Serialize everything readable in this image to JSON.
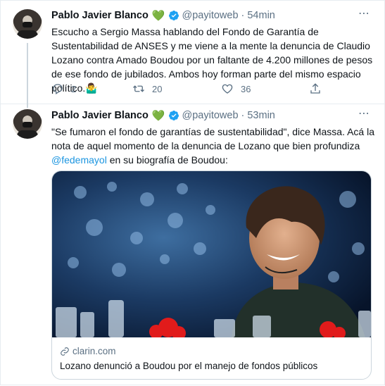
{
  "tweets": [
    {
      "author": "Pablo Javier Blanco",
      "emoji": "💚",
      "handle": "@payitoweb",
      "separator": "·",
      "time": "54min",
      "text": "Escucho a Sergio Massa hablando del Fondo de Garantía de Sustentabilidad de ANSES y me viene a la mente la denuncia de Claudio Lozano contra Amado Boudou por un faltante de 4.200 millones de pesos de ese fondo de jubilados. Ambos hoy forman parte del mismo espacio político.🤷‍♂️",
      "replies": "2",
      "retweets": "20",
      "likes": "36"
    },
    {
      "author": "Pablo Javier Blanco",
      "emoji": "💚",
      "handle": "@payitoweb",
      "separator": "·",
      "time": "53min",
      "text_before": "\"Se fumaron el fondo de garantías de sustentabilidad\", dice Massa. Acá la nota de aquel momento de la denuncia de Lozano que bien profundiza ",
      "mention": "@fedemayol",
      "text_after": " en su biografía de Boudou:",
      "card": {
        "domain": "clarin.com",
        "title": "Lozano denunció a Boudou por el manejo de fondos públicos"
      }
    }
  ]
}
